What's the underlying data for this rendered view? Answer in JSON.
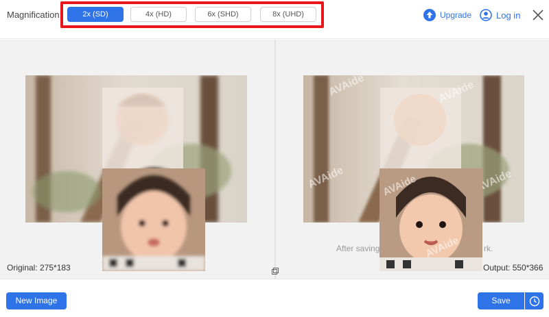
{
  "toolbar": {
    "magnification_label": "Magnification:",
    "options": [
      "2x (SD)",
      "4x (HD)",
      "6x (SHD)",
      "8x (UHD)"
    ],
    "selected_index": 0,
    "upgrade_label": "Upgrade",
    "login_label": "Log in",
    "accent_color": "#2f73e8",
    "highlight_color": "#e8161b"
  },
  "preview": {
    "original_caption": "Original: 275*183",
    "output_caption": "Output: 550*366",
    "save_note": "After saving",
    "save_note_tail": "rk.",
    "watermark": "AVAide"
  },
  "footer": {
    "new_image_label": "New Image",
    "save_label": "Save"
  },
  "icons": {
    "upgrade": "upload-arrow-icon",
    "login": "user-icon",
    "close": "close-icon",
    "history": "clock-icon",
    "compare": "compare-icon"
  }
}
